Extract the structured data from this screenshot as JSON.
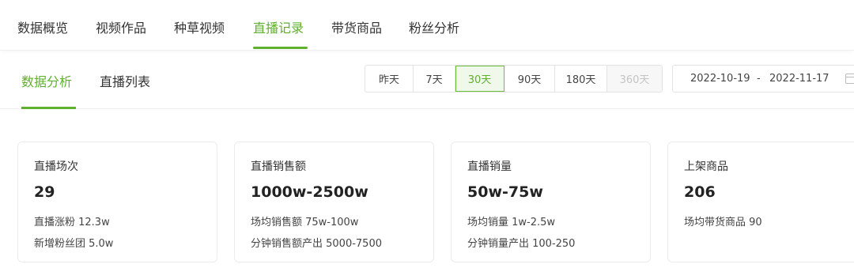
{
  "top_tabs": [
    {
      "label": "数据概览"
    },
    {
      "label": "视频作品"
    },
    {
      "label": "种草视频"
    },
    {
      "label": "直播记录"
    },
    {
      "label": "带货商品"
    },
    {
      "label": "粉丝分析"
    }
  ],
  "top_active_index": 3,
  "sub_tabs": [
    {
      "label": "数据分析"
    },
    {
      "label": "直播列表"
    }
  ],
  "sub_active_index": 0,
  "range_buttons": [
    {
      "label": "昨天"
    },
    {
      "label": "7天"
    },
    {
      "label": "30天"
    },
    {
      "label": "90天"
    },
    {
      "label": "180天"
    },
    {
      "label": "360天"
    }
  ],
  "range_active_index": 2,
  "range_disabled_index": 5,
  "date_range": {
    "start": "2022-10-19",
    "separator": "-",
    "end": "2022-11-17"
  },
  "cards": [
    {
      "label": "直播场次",
      "value": "29",
      "sub1": "直播涨粉 12.3w",
      "sub2": "新增粉丝团 5.0w"
    },
    {
      "label": "直播销售额",
      "value": "1000w-2500w",
      "sub1": "场均销售额 75w-100w",
      "sub2": "分钟销售额产出 5000-7500"
    },
    {
      "label": "直播销量",
      "value": "50w-75w",
      "sub1": "场均销量 1w-2.5w",
      "sub2": "分钟销量产出 100-250"
    },
    {
      "label": "上架商品",
      "value": "206",
      "sub1": "场均带货商品 90",
      "sub2": ""
    }
  ],
  "colors": {
    "accent": "#5fb02e",
    "text": "#333333",
    "border": "#ececec"
  },
  "icons": {
    "date_picker": "calendar-icon"
  }
}
